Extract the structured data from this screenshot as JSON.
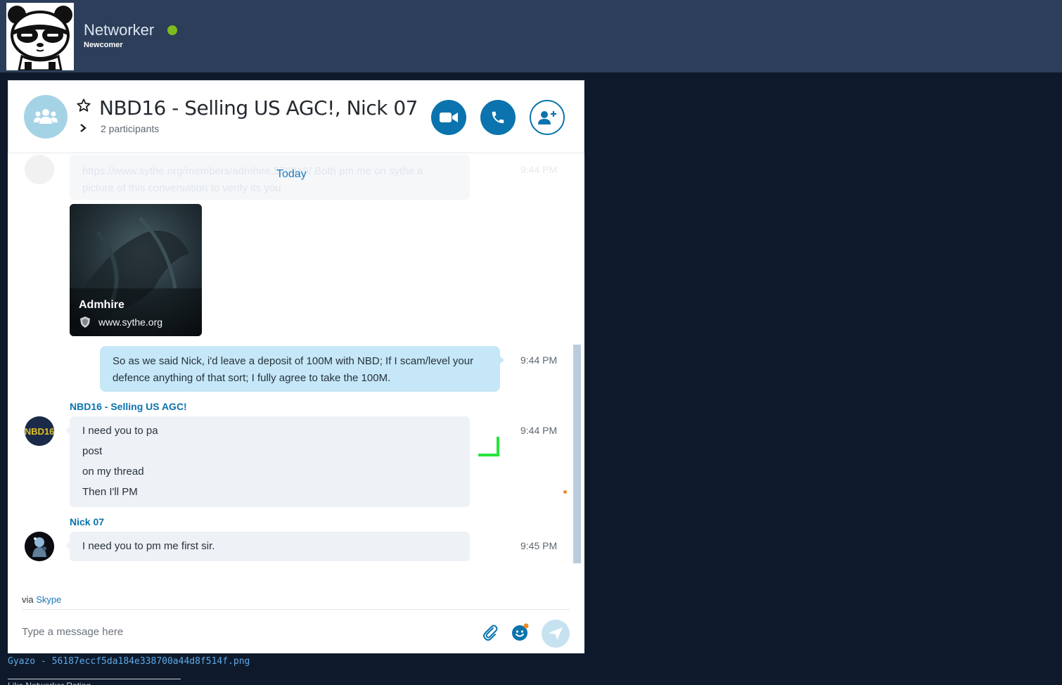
{
  "profile": {
    "username": "Networker",
    "title": "Newcomer",
    "status_color": "#7dbb1f"
  },
  "chat": {
    "title": "NBD16 - Selling US AGC!, Nick 07",
    "participants": "2 participants",
    "day_divider": "Today",
    "faded_message": {
      "text": "https://www.sythe.org/members/admhire.576919/ Both pm me on sythe a picture of this conversation to verify its you",
      "time": "9:44 PM"
    },
    "link_preview": {
      "title": "Admhire",
      "site": "www.sythe.org"
    },
    "messages": [
      {
        "direction": "out",
        "text": "So as we said Nick, i'd leave a deposit of 100M with NBD; If I scam/level your defence anything of that sort; I fully agree to take the 100M.",
        "time": "9:44 PM"
      },
      {
        "direction": "in",
        "sender": "NBD16 - Selling US AGC!",
        "avatar_text": "NBD16",
        "lines": [
          "I need you to pa",
          "post",
          "on my thread",
          "Then I'll PM"
        ],
        "time": "9:44 PM"
      },
      {
        "direction": "in",
        "sender": "Nick 07",
        "lines": [
          "I need you to pm me first sir."
        ],
        "time": "9:45 PM"
      }
    ],
    "via_prefix": "via",
    "via_link": "Skype",
    "composer_placeholder": "Type a message here"
  },
  "footer": {
    "caption": "Gyazo - 56187eccf5da184e338700a44d8f514f.png",
    "cut_text": "Like Networker Rating"
  },
  "colors": {
    "accent": "#0b73ad",
    "outgoing_bubble": "#c5e7f7",
    "incoming_bubble": "#eef1f5",
    "topbar": "#2c3e5a",
    "background": "#0e1a2b"
  }
}
